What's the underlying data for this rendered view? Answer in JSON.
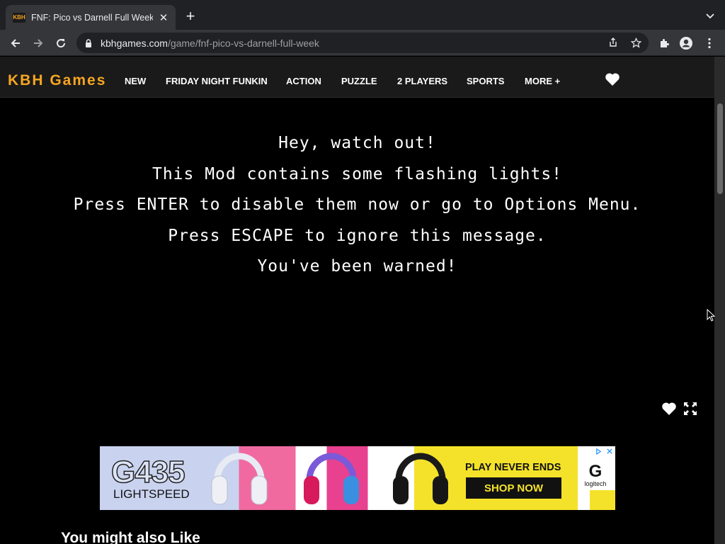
{
  "browser": {
    "tab_favicon": "KBH",
    "tab_title": "FNF: Pico vs Darnell Full Week",
    "tab_close": "✕",
    "new_tab": "+",
    "url_host": "kbhgames.com",
    "url_path": "/game/fnf-pico-vs-darnell-full-week"
  },
  "site": {
    "logo": "KBH Games",
    "nav": [
      "NEW",
      "FRIDAY NIGHT FUNKIN",
      "ACTION",
      "PUZZLE",
      "2 PLAYERS",
      "SPORTS",
      "MORE +"
    ]
  },
  "game": {
    "warning_lines": [
      "Hey, watch out!",
      "This Mod contains some flashing lights!",
      "Press ENTER to disable them now or go to Options Menu.",
      "Press ESCAPE to ignore this message.",
      "You've been warned!"
    ]
  },
  "ad": {
    "model": "G435",
    "subtitle": "LIGHTSPEED",
    "tagline": "PLAY NEVER ENDS",
    "cta": "SHOP NOW",
    "brand": "logitech",
    "brand_mark": "G"
  },
  "section": {
    "title": "You might also Like"
  },
  "colors": {
    "accent": "#f5a623",
    "header_bg": "#1a1a1a",
    "page_bg": "#000000"
  }
}
